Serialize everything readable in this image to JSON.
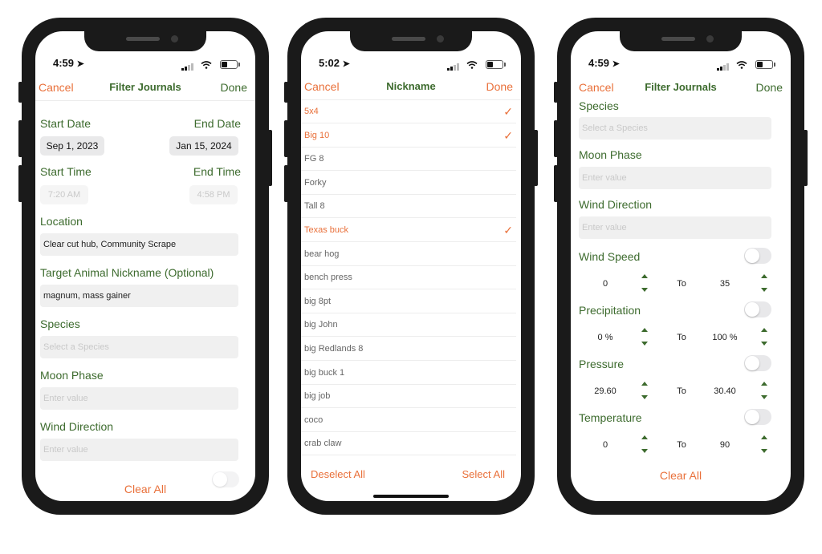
{
  "status": {
    "time_left": "4:59",
    "time_middle": "5:02",
    "time_right": "4:59"
  },
  "colors": {
    "accent_orange": "#e9703a",
    "label_green": "#3d6b2e"
  },
  "left_screen": {
    "nav": {
      "cancel": "Cancel",
      "title": "Filter Journals",
      "done": "Done"
    },
    "start_date_label": "Start Date",
    "end_date_label": "End Date",
    "start_date": "Sep 1, 2023",
    "end_date": "Jan 15, 2024",
    "start_time_label": "Start Time",
    "end_time_label": "End Time",
    "start_time": "7:20 AM",
    "end_time": "4:58 PM",
    "location_label": "Location",
    "location_value": "Clear cut hub, Community Scrape",
    "nickname_label": "Target Animal Nickname (Optional)",
    "nickname_value": "magnum, mass gainer",
    "species_label": "Species",
    "species_placeholder": "Select a Species",
    "moon_label": "Moon Phase",
    "moon_placeholder": "Enter value",
    "wind_dir_label": "Wind Direction",
    "wind_dir_placeholder": "Enter value",
    "clear_all": "Clear All"
  },
  "middle_screen": {
    "nav": {
      "cancel": "Cancel",
      "title": "Nickname",
      "done": "Done"
    },
    "items": [
      {
        "name": "5x4",
        "selected": true
      },
      {
        "name": "Big 10",
        "selected": true
      },
      {
        "name": "FG 8",
        "selected": false
      },
      {
        "name": "Forky",
        "selected": false
      },
      {
        "name": "Tall 8",
        "selected": false
      },
      {
        "name": "Texas buck",
        "selected": true
      },
      {
        "name": "bear hog",
        "selected": false
      },
      {
        "name": "bench press",
        "selected": false
      },
      {
        "name": "big 8pt",
        "selected": false
      },
      {
        "name": "big John",
        "selected": false
      },
      {
        "name": "big Redlands 8",
        "selected": false
      },
      {
        "name": "big buck 1",
        "selected": false
      },
      {
        "name": "big job",
        "selected": false
      },
      {
        "name": "coco",
        "selected": false
      },
      {
        "name": "crab claw",
        "selected": false
      }
    ],
    "checkmark": "✓",
    "deselect_all": "Deselect All",
    "select_all": "Select All"
  },
  "right_screen": {
    "nav": {
      "cancel": "Cancel",
      "title": "Filter Journals",
      "done": "Done"
    },
    "species_label": "Species",
    "species_placeholder": "Select a Species",
    "moon_label": "Moon Phase",
    "moon_placeholder": "Enter value",
    "wind_dir_label": "Wind Direction",
    "wind_dir_placeholder": "Enter value",
    "ranges": [
      {
        "label": "Wind Speed",
        "min": "0",
        "to": "To",
        "max": "35",
        "enabled": false
      },
      {
        "label": "Precipitation",
        "min": "0 %",
        "to": "To",
        "max": "100 %",
        "enabled": false
      },
      {
        "label": "Pressure",
        "min": "29.60",
        "to": "To",
        "max": "30.40",
        "enabled": false
      },
      {
        "label": "Temperature",
        "min": "0",
        "to": "To",
        "max": "90",
        "enabled": false
      }
    ],
    "clear_all": "Clear All"
  }
}
